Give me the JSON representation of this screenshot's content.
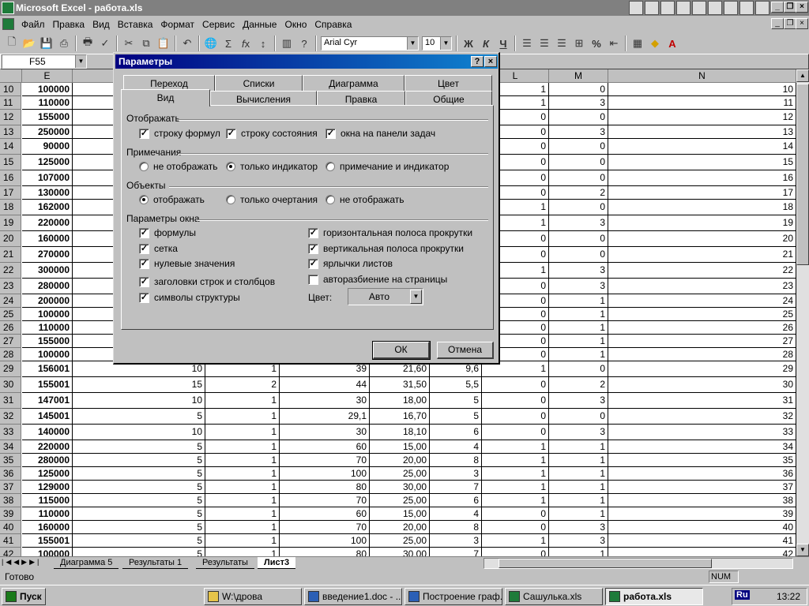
{
  "window": {
    "title": "Microsoft Excel - работа.xls"
  },
  "menu": [
    "Файл",
    "Правка",
    "Вид",
    "Вставка",
    "Формат",
    "Сервис",
    "Данные",
    "Окно",
    "Справка"
  ],
  "toolbar": {
    "font": "Arial Cyr",
    "size": "10",
    "bold": "Ж",
    "italic": "К",
    "underline": "Ч",
    "percent": "%"
  },
  "namebox": "F55",
  "columns": {
    "E": "E",
    "L": "L",
    "M": "M",
    "N": "N"
  },
  "rows": [
    {
      "n": "10",
      "e": "100000",
      "l": "1",
      "m": "0"
    },
    {
      "n": "11",
      "e": "110000",
      "l": "1",
      "m": "3"
    },
    {
      "n": "12",
      "e": "155000",
      "l": "0",
      "m": "0"
    },
    {
      "n": "13",
      "e": "250000",
      "l": "0",
      "m": "3"
    },
    {
      "n": "14",
      "e": "90000",
      "l": "0",
      "m": "0"
    },
    {
      "n": "15",
      "e": "125000",
      "l": "0",
      "m": "0"
    },
    {
      "n": "16",
      "e": "107000",
      "l": "0",
      "m": "0"
    },
    {
      "n": "17",
      "e": "130000",
      "l": "0",
      "m": "2"
    },
    {
      "n": "18",
      "e": "162000",
      "l": "1",
      "m": "0"
    },
    {
      "n": "19",
      "e": "220000",
      "l": "1",
      "m": "3"
    },
    {
      "n": "20",
      "e": "160000",
      "l": "0",
      "m": "0"
    },
    {
      "n": "21",
      "e": "270000",
      "l": "0",
      "m": "0"
    },
    {
      "n": "22",
      "e": "300000",
      "l": "1",
      "m": "3"
    },
    {
      "n": "23",
      "e": "280000",
      "l": "0",
      "m": "3"
    },
    {
      "n": "24",
      "e": "200000",
      "l": "0",
      "m": "1"
    },
    {
      "n": "25",
      "e": "100000",
      "l": "0",
      "m": "1"
    },
    {
      "n": "26",
      "e": "110000",
      "l": "0",
      "m": "1"
    },
    {
      "n": "27",
      "e": "155000",
      "l": "0",
      "m": "1"
    },
    {
      "n": "28",
      "e": "100000",
      "l": "0",
      "m": "1"
    },
    {
      "n": "29",
      "e": "156001",
      "f": "10",
      "g": "1",
      "h": "39",
      "i": "21,60",
      "j": "9,6",
      "l": "1",
      "m": "0"
    },
    {
      "n": "30",
      "e": "155001",
      "f": "15",
      "g": "2",
      "h": "44",
      "i": "31,50",
      "j": "5,5",
      "l": "0",
      "m": "2"
    },
    {
      "n": "31",
      "e": "147001",
      "f": "10",
      "g": "1",
      "h": "30",
      "i": "18,00",
      "j": "5",
      "l": "0",
      "m": "3"
    },
    {
      "n": "32",
      "e": "145001",
      "f": "5",
      "g": "1",
      "h": "29,1",
      "i": "16,70",
      "j": "5",
      "l": "0",
      "m": "0"
    },
    {
      "n": "33",
      "e": "140000",
      "f": "10",
      "g": "1",
      "h": "30",
      "i": "18,10",
      "j": "6",
      "l": "0",
      "m": "3"
    },
    {
      "n": "34",
      "e": "220000",
      "f": "5",
      "g": "1",
      "h": "60",
      "i": "15,00",
      "j": "4",
      "l": "1",
      "m": "1"
    },
    {
      "n": "35",
      "e": "280000",
      "f": "5",
      "g": "1",
      "h": "70",
      "i": "20,00",
      "j": "8",
      "l": "1",
      "m": "1"
    },
    {
      "n": "36",
      "e": "125000",
      "f": "5",
      "g": "1",
      "h": "100",
      "i": "25,00",
      "j": "3",
      "l": "1",
      "m": "1"
    },
    {
      "n": "37",
      "e": "129000",
      "f": "5",
      "g": "1",
      "h": "80",
      "i": "30,00",
      "j": "7",
      "l": "1",
      "m": "1"
    },
    {
      "n": "38",
      "e": "115000",
      "f": "5",
      "g": "1",
      "h": "70",
      "i": "25,00",
      "j": "6",
      "l": "1",
      "m": "1"
    },
    {
      "n": "39",
      "e": "110000",
      "f": "5",
      "g": "1",
      "h": "60",
      "i": "15,00",
      "j": "4",
      "l": "0",
      "m": "1"
    },
    {
      "n": "40",
      "e": "160000",
      "f": "5",
      "g": "1",
      "h": "70",
      "i": "20,00",
      "j": "8",
      "l": "0",
      "m": "3"
    },
    {
      "n": "41",
      "e": "155001",
      "f": "5",
      "g": "1",
      "h": "100",
      "i": "25,00",
      "j": "3",
      "l": "1",
      "m": "3"
    },
    {
      "n": "42",
      "e": "100000",
      "f": "5",
      "g": "1",
      "h": "80",
      "i": "30,00",
      "j": "7",
      "l": "0",
      "m": "1"
    }
  ],
  "sheet_tabs": [
    "Диаграмма 5",
    "Результаты 1",
    "Результаты",
    "Лист3"
  ],
  "status": {
    "ready": "Готово",
    "num": "NUM"
  },
  "taskbar": {
    "start": "Пуск",
    "tasks": [
      "W:\\дрова",
      "введение1.doc - ...",
      "Построение граф...",
      "Сашулька.xls",
      "работа.xls"
    ],
    "lang": "Ru",
    "clock": "13:22"
  },
  "dialog": {
    "title": "Параметры",
    "help": "?",
    "close": "×",
    "tabs_row1": [
      "Переход",
      "Списки",
      "Диаграмма",
      "Цвет"
    ],
    "tabs_row2": [
      "Вид",
      "Вычисления",
      "Правка",
      "Общие"
    ],
    "show_group": "Отображать",
    "show_opts": [
      {
        "label": "строку формул",
        "checked": true
      },
      {
        "label": "строку состояния",
        "checked": true
      },
      {
        "label": "окна на панели задач",
        "checked": true
      }
    ],
    "comments_group": "Примечания",
    "comments_opts": [
      {
        "label": "не отображать",
        "selected": false
      },
      {
        "label": "только индикатор",
        "selected": true
      },
      {
        "label": "примечание и индикатор",
        "selected": false
      }
    ],
    "objects_group": "Объекты",
    "objects_opts": [
      {
        "label": "отображать",
        "selected": true
      },
      {
        "label": "только очертания",
        "selected": false
      },
      {
        "label": "не отображать",
        "selected": false
      }
    ],
    "window_group": "Параметры окна",
    "window_left": [
      {
        "label": "формулы",
        "checked": true
      },
      {
        "label": "сетка",
        "checked": true
      },
      {
        "label": "нулевые значения",
        "checked": true
      },
      {
        "label": "заголовки строк и столбцов",
        "checked": true
      },
      {
        "label": "символы структуры",
        "checked": true
      }
    ],
    "window_right": [
      {
        "label": "горизонтальная полоса прокрутки",
        "checked": true
      },
      {
        "label": "вертикальная полоса прокрутки",
        "checked": true
      },
      {
        "label": "ярлычки листов",
        "checked": true
      },
      {
        "label": "авторазбиение на страницы",
        "checked": false
      }
    ],
    "color_label": "Цвет:",
    "color_value": "Авто",
    "ok": "ОК",
    "cancel": "Отмена"
  }
}
